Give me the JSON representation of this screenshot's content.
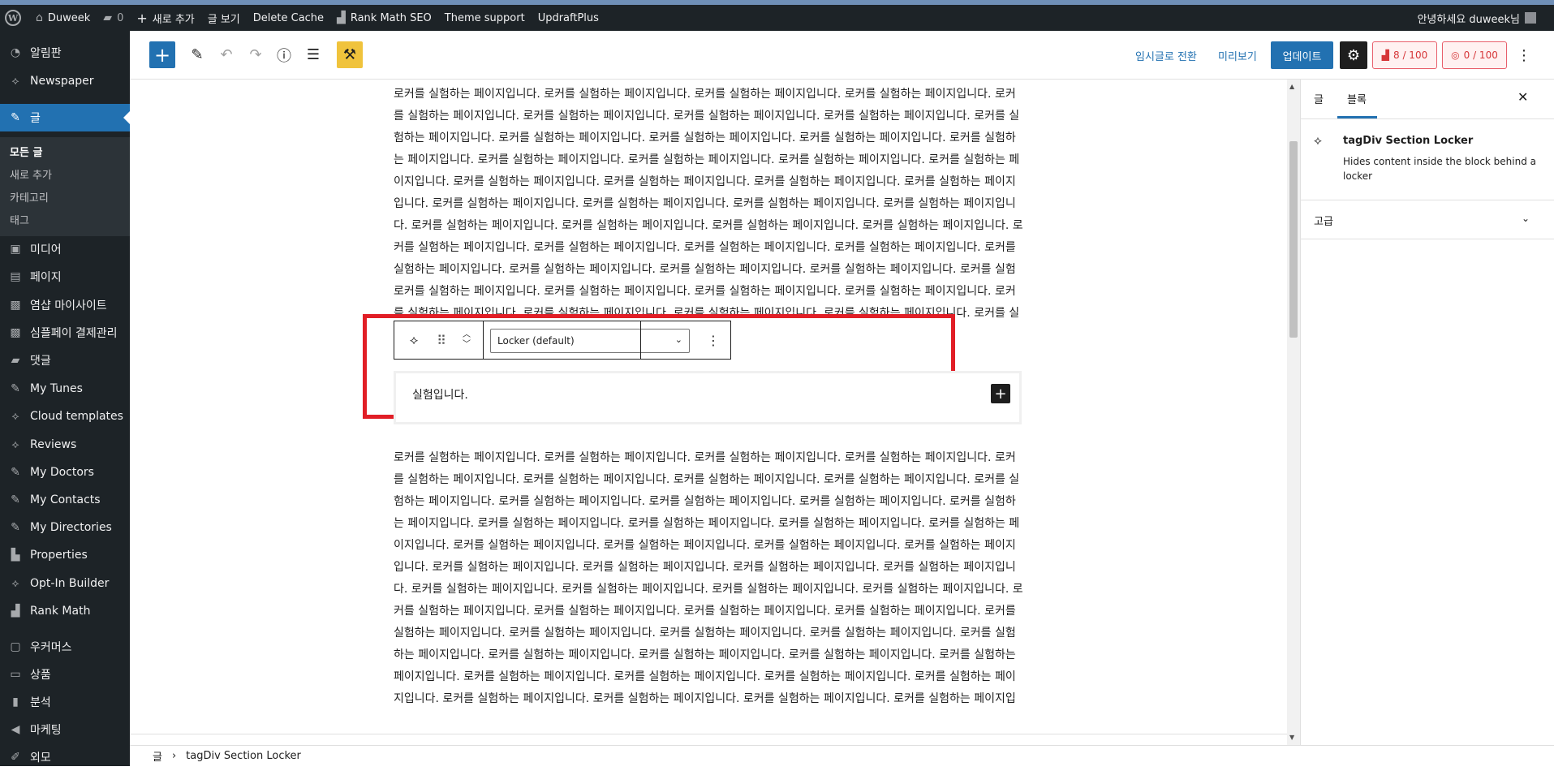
{
  "adminbar": {
    "site_name": "Duweek",
    "comments_count": "0",
    "new_label": "새로 추가",
    "view_post": "글 보기",
    "delete_cache": "Delete Cache",
    "rank_math": "Rank Math SEO",
    "theme_support": "Theme support",
    "updraft": "UpdraftPlus",
    "greeting": "안녕하세요 duweek님"
  },
  "sidebar": {
    "items": [
      {
        "label": "알림판",
        "icon": "dashboard-icon"
      },
      {
        "label": "Newspaper",
        "icon": "tagdiv-icon"
      },
      {
        "label": "글",
        "icon": "pin-icon"
      },
      {
        "label": "미디어",
        "icon": "media-icon"
      },
      {
        "label": "페이지",
        "icon": "page-icon"
      },
      {
        "label": "염샵 마이사이트",
        "icon": "lock-icon"
      },
      {
        "label": "심플페이 결제관리",
        "icon": "lock-icon"
      },
      {
        "label": "댓글",
        "icon": "comment-icon"
      },
      {
        "label": "My Tunes",
        "icon": "pin-icon"
      },
      {
        "label": "Cloud templates",
        "icon": "tagdiv-icon"
      },
      {
        "label": "Reviews",
        "icon": "tagdiv-icon"
      },
      {
        "label": "My Doctors",
        "icon": "pin-icon"
      },
      {
        "label": "My Contacts",
        "icon": "pin-icon"
      },
      {
        "label": "My Directories",
        "icon": "pin-icon"
      },
      {
        "label": "Properties",
        "icon": "building-icon"
      },
      {
        "label": "Opt-In Builder",
        "icon": "tagdiv-icon"
      },
      {
        "label": "Rank Math",
        "icon": "chart-icon"
      },
      {
        "label": "우커머스",
        "icon": "woo-icon"
      },
      {
        "label": "상품",
        "icon": "archive-icon"
      },
      {
        "label": "분석",
        "icon": "bar-chart-icon"
      },
      {
        "label": "마케팅",
        "icon": "megaphone-icon"
      },
      {
        "label": "외모",
        "icon": "brush-icon"
      }
    ],
    "submenu": [
      "모든 글",
      "새로 추가",
      "카테고리",
      "태그"
    ]
  },
  "header": {
    "switch_draft": "임시글로 전환",
    "preview": "미리보기",
    "update": "업데이트",
    "score1": "8 / 100",
    "score2": "0 / 100"
  },
  "content": {
    "sentence": "로커를 실험하는 페이지입니다.",
    "locker_select": "Locker (default)",
    "locker_inner_text": "실험입니다."
  },
  "panel": {
    "tab_post": "글",
    "tab_block": "블록",
    "block_name": "tagDiv Section Locker",
    "block_desc": "Hides content inside the block behind a locker",
    "advanced": "고급"
  },
  "breadcrumb": {
    "root": "글",
    "current": "tagDiv Section Locker"
  },
  "colors": {
    "wp_blue": "#2271b1",
    "admin_dark": "#1d2327",
    "highlight_red": "#e11e26",
    "tools_yellow": "#f0c33c"
  }
}
